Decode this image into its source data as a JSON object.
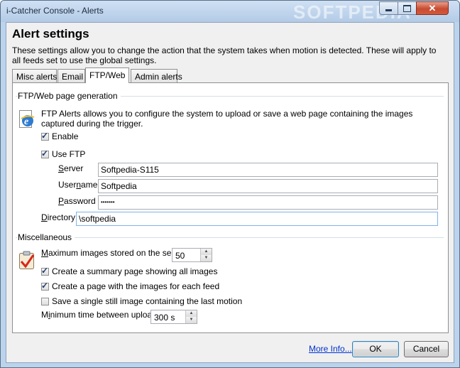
{
  "window": {
    "title": "i-Catcher Console - Alerts",
    "watermark": "SOFTPEDIA",
    "close_glyph": "✕"
  },
  "header": {
    "title": "Alert settings",
    "description": "These settings allow you to change the action that the system takes when motion is detected. These will apply to all feeds set to use the global settings."
  },
  "tabs": [
    {
      "label": "Misc alerts",
      "active": false
    },
    {
      "label": "Email",
      "active": false
    },
    {
      "label": "FTP/Web",
      "active": true
    },
    {
      "label": "Admin alerts",
      "active": false
    }
  ],
  "ftp_section": {
    "title": "FTP/Web page generation",
    "icon": "ie-globe-icon",
    "info": "FTP Alerts allows you to configure the system to upload or save a web page containing the images captured during the trigger.",
    "enable": {
      "label": "Enable",
      "checked": true
    },
    "use_ftp": {
      "label": "Use FTP",
      "checked": true
    },
    "server": {
      "label_u": "S",
      "label_rest": "erver",
      "value": "Softpedia-S115"
    },
    "username": {
      "label_pre": "User",
      "label_u": "n",
      "label_rest": "ame",
      "value": "Softpedia"
    },
    "password": {
      "label_u": "P",
      "label_rest": "assword",
      "value": "•••••••"
    },
    "directory": {
      "label_u": "D",
      "label_rest": "irectory",
      "value": "\\softpedia"
    }
  },
  "misc_section": {
    "title": "Miscellaneous",
    "icon": "clipboard-check-icon",
    "max_images": {
      "label_u": "M",
      "label_rest": "aximum images stored on the server",
      "value": "50"
    },
    "summary_page": {
      "label": "Create a summary page showing all images",
      "checked": true
    },
    "page_per_feed": {
      "label": "Create a page with the images for each feed",
      "checked": true
    },
    "single_still": {
      "label": "Save a single still image containing the last motion",
      "checked": false
    },
    "min_time": {
      "label_pre": "M",
      "label_u": "i",
      "label_rest": "nimum time between uploads",
      "value": "300 s"
    }
  },
  "footer": {
    "more_info": "More Info...",
    "ok": "OK",
    "cancel": "Cancel"
  },
  "glyphs": {
    "check": "✓",
    "up": "▲",
    "down": "▼"
  }
}
